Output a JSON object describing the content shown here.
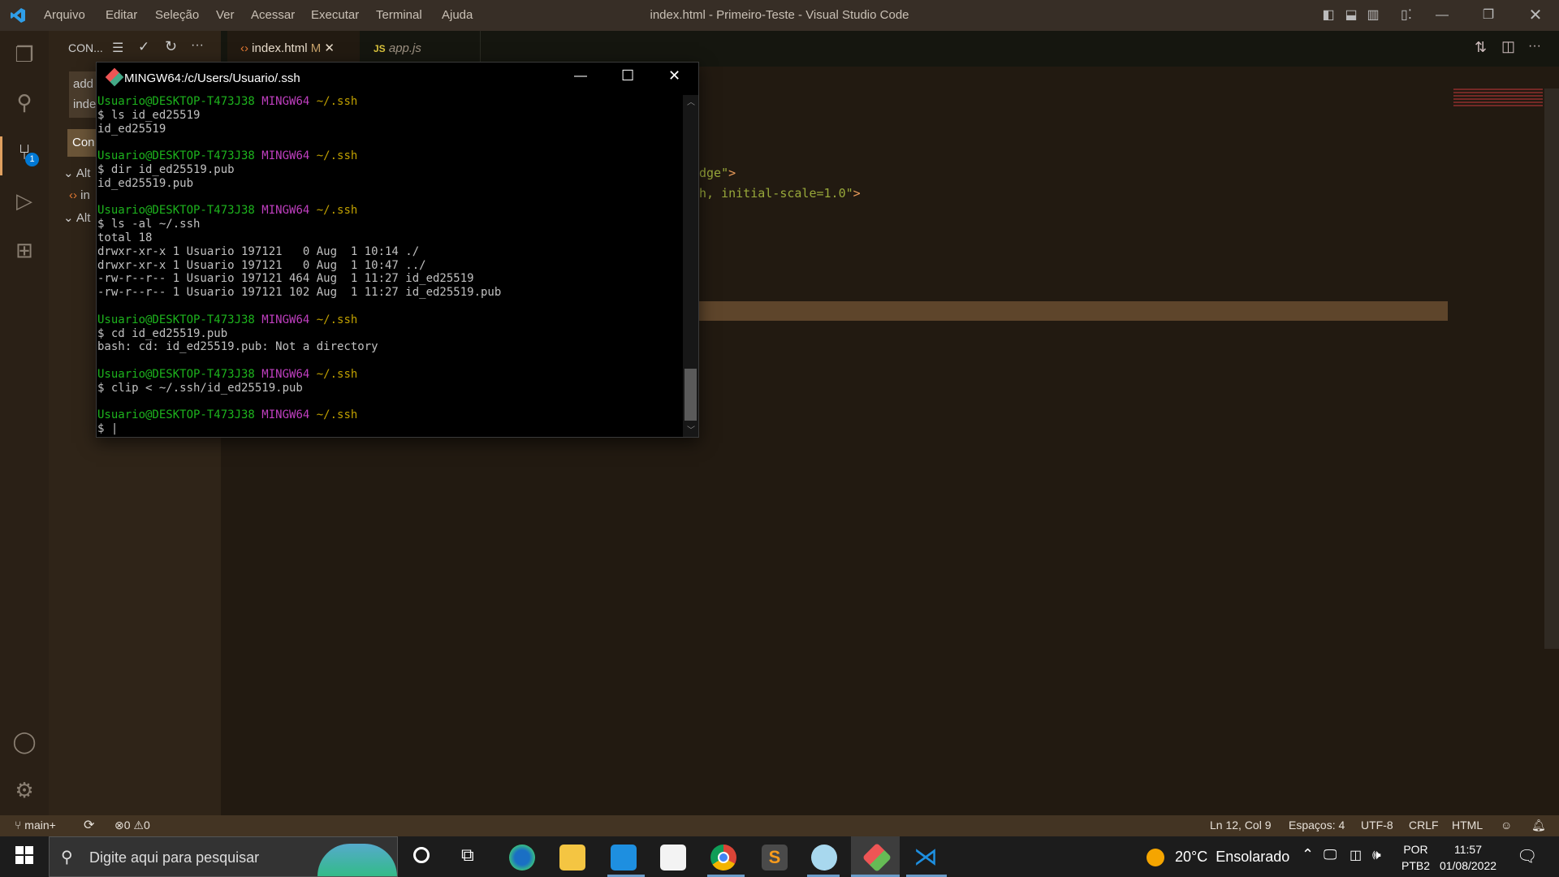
{
  "titlebar": {
    "menu": [
      "Arquivo",
      "Editar",
      "Seleção",
      "Ver",
      "Acessar",
      "Executar",
      "Terminal",
      "Ajuda"
    ],
    "title": "index.html - Primeiro-Teste - Visual Studio Code"
  },
  "activity": {
    "scm_badge": "1"
  },
  "sidebar": {
    "header": "CON...",
    "commit_message_lines": [
      "add",
      "inde"
    ],
    "commit_button": "Con",
    "tree": [
      {
        "label": "Alt",
        "type": "group"
      },
      {
        "label": "in",
        "type": "file"
      },
      {
        "label": "Alt",
        "type": "group"
      }
    ]
  },
  "tabs": [
    {
      "label": "index.html",
      "badge": "M",
      "icon": "html-icon",
      "active": true
    },
    {
      "label": "app.js",
      "icon_text": "JS",
      "active": false
    }
  ],
  "editor": {
    "lines": [
      {
        "pre": "dge\"",
        "tag": ">"
      },
      {
        "pre": "h, initial-scale=1.0\"",
        "tag": ">"
      }
    ]
  },
  "terminal": {
    "title": "MINGW64:/c/Users/Usuario/.ssh",
    "prompt": {
      "user": "Usuario@DESKTOP-T473J38",
      "host": "MINGW64",
      "path": "~/.ssh"
    },
    "lines": [
      {
        "kind": "prompt"
      },
      {
        "kind": "text",
        "text": "$ ls id_ed25519"
      },
      {
        "kind": "text",
        "text": "id_ed25519"
      },
      {
        "kind": "text",
        "text": ""
      },
      {
        "kind": "prompt"
      },
      {
        "kind": "text",
        "text": "$ dir id_ed25519.pub"
      },
      {
        "kind": "text",
        "text": "id_ed25519.pub"
      },
      {
        "kind": "text",
        "text": ""
      },
      {
        "kind": "prompt"
      },
      {
        "kind": "text",
        "text": "$ ls -al ~/.ssh"
      },
      {
        "kind": "text",
        "text": "total 18"
      },
      {
        "kind": "text",
        "text": "drwxr-xr-x 1 Usuario 197121   0 Aug  1 10:14 ./"
      },
      {
        "kind": "text",
        "text": "drwxr-xr-x 1 Usuario 197121   0 Aug  1 10:47 ../"
      },
      {
        "kind": "text",
        "text": "-rw-r--r-- 1 Usuario 197121 464 Aug  1 11:27 id_ed25519"
      },
      {
        "kind": "text",
        "text": "-rw-r--r-- 1 Usuario 197121 102 Aug  1 11:27 id_ed25519.pub"
      },
      {
        "kind": "text",
        "text": ""
      },
      {
        "kind": "prompt"
      },
      {
        "kind": "text",
        "text": "$ cd id_ed25519.pub"
      },
      {
        "kind": "text",
        "text": "bash: cd: id_ed25519.pub: Not a directory"
      },
      {
        "kind": "text",
        "text": ""
      },
      {
        "kind": "prompt"
      },
      {
        "kind": "text",
        "text": "$ clip < ~/.ssh/id_ed25519.pub"
      },
      {
        "kind": "text",
        "text": ""
      },
      {
        "kind": "prompt"
      },
      {
        "kind": "text",
        "text": "$ |"
      }
    ]
  },
  "statusbar": {
    "branch": "main+",
    "errors": "0",
    "warnings": "0",
    "position": "Ln 12, Col 9",
    "spaces": "Espaços: 4",
    "encoding": "UTF-8",
    "eol": "CRLF",
    "language": "HTML"
  },
  "taskbar": {
    "search_placeholder": "Digite aqui para pesquisar",
    "weather": "20°C  Ensolarado",
    "lang1": "POR",
    "lang2": "PTB2",
    "time": "11:57",
    "date": "01/08/2022",
    "apps": [
      "edge",
      "file-explorer",
      "mail",
      "store",
      "chrome",
      "sublime-text",
      "paint",
      "git-bash",
      "vscode"
    ]
  },
  "colors": {
    "prompt_user": "#1db31d",
    "prompt_host": "#c03fc0",
    "prompt_path": "#c0a000",
    "statusbar": "#433423",
    "accent": "#0078d4"
  }
}
